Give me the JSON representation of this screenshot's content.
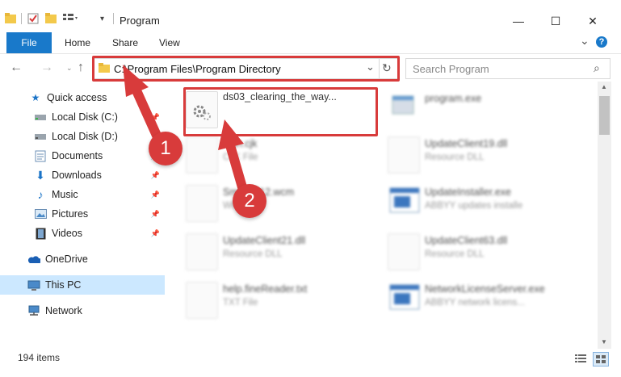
{
  "window": {
    "title": "Program",
    "min_glyph": "—",
    "max_glyph": "☐",
    "close_glyph": "✕"
  },
  "ribbon": {
    "tabs": [
      "File",
      "Home",
      "Share",
      "View"
    ],
    "expand_glyph": "⌄",
    "help_glyph": "?"
  },
  "nav": {
    "back_glyph": "←",
    "forward_glyph": "→",
    "up_glyph": "↑",
    "address": "C:\\Program Files\\Program Directory",
    "refresh_glyph": "↻",
    "dropdown_glyph": "⌄",
    "search_placeholder": "Search Program",
    "search_glyph": "⌕"
  },
  "sidebar": {
    "items": [
      {
        "label": "Quick access",
        "icon": "star-icon"
      },
      {
        "label": "Local Disk (C:)",
        "icon": "drive-icon"
      },
      {
        "label": "Local Disk (D:)",
        "icon": "drive-icon"
      },
      {
        "label": "Documents",
        "icon": "documents-icon"
      },
      {
        "label": "Downloads",
        "icon": "download-icon"
      },
      {
        "label": "Music",
        "icon": "music-icon"
      },
      {
        "label": "Pictures",
        "icon": "pictures-icon"
      },
      {
        "label": "Videos",
        "icon": "videos-icon"
      },
      {
        "label": "OneDrive",
        "icon": "cloud-icon"
      },
      {
        "label": "This PC",
        "icon": "computer-icon"
      },
      {
        "label": "Network",
        "icon": "network-icon"
      }
    ]
  },
  "files": {
    "highlighted": {
      "name": "ds03_clearing_the_way..."
    },
    "items": [
      {
        "name": "program.exe",
        "type": ""
      },
      {
        "name": "lean.cjk",
        "type": "CJK File"
      },
      {
        "name": "UpdateClient19.dll",
        "type": "Resource DLL"
      },
      {
        "name": "SmartIP12.wcm",
        "type": "WCM File"
      },
      {
        "name": "UpdateInstaller.exe",
        "type": "ABBYY updates installe"
      },
      {
        "name": "UpdateClient21.dll",
        "type": "Resource DLL"
      },
      {
        "name": "UpdateClient63.dll",
        "type": "Resource DLL"
      },
      {
        "name": "help.fineReader.txt",
        "type": "TXT File"
      },
      {
        "name": "NetworkLicenseServer.exe",
        "type": "ABBYY network licens..."
      }
    ]
  },
  "status": {
    "count": "194 items"
  },
  "annotations": {
    "badge_1": "1",
    "badge_2": "2",
    "color": "#d83b3b"
  }
}
